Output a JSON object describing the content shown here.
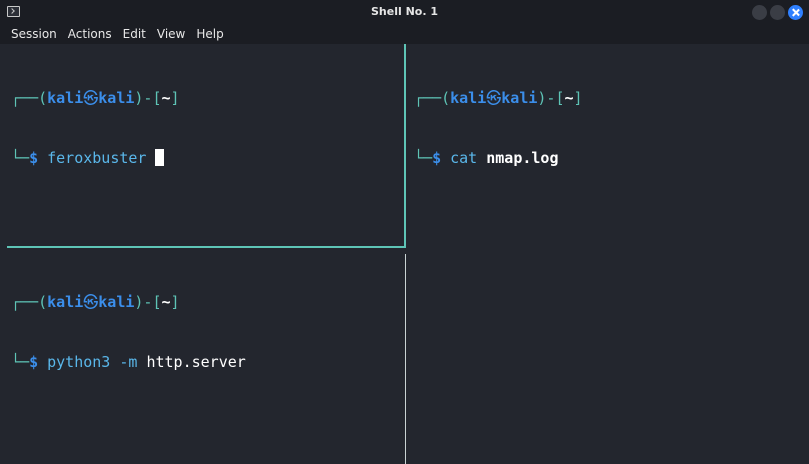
{
  "window": {
    "title": "Shell No. 1"
  },
  "menu": [
    "Session",
    "Actions",
    "Edit",
    "View",
    "Help"
  ],
  "prompt": {
    "top_open": "┌──(",
    "user": "kali",
    "separator": "㉿",
    "host": "kali",
    "mid": ")-[",
    "dir": "~",
    "close": "]",
    "bottom": "└─",
    "dollar": "$"
  },
  "panes": {
    "top_left": {
      "command": "feroxbuster",
      "args": "",
      "args_bold": ""
    },
    "bottom_left": {
      "command": "python3",
      "args": "-m",
      "args_bold": "http.server"
    },
    "right": {
      "command": "cat",
      "args": "",
      "args_bold": "nmap.log"
    }
  },
  "colors": {
    "background": "#23262e",
    "prompt_lines": "#5ec4b6",
    "user": "#3b8eea",
    "command": "#5ab7ea",
    "close_button": "#2f80ff"
  }
}
